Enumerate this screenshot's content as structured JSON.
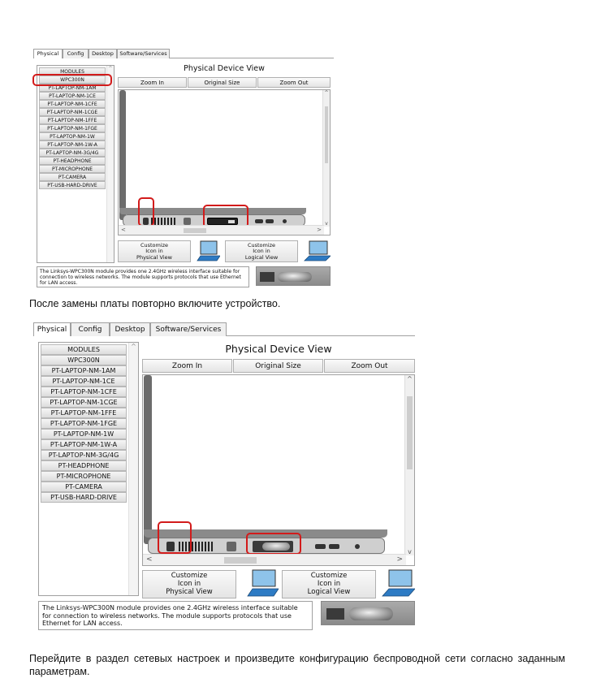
{
  "tabs": [
    "Physical",
    "Config",
    "Desktop",
    "Software/Services"
  ],
  "modules": [
    "MODULES",
    "WPC300N",
    "PT-LAPTOP-NM-1AM",
    "PT-LAPTOP-NM-1CE",
    "PT-LAPTOP-NM-1CFE",
    "PT-LAPTOP-NM-1CGE",
    "PT-LAPTOP-NM-1FFE",
    "PT-LAPTOP-NM-1FGE",
    "PT-LAPTOP-NM-1W",
    "PT-LAPTOP-NM-1W-A",
    "PT-LAPTOP-NM-3G/4G",
    "PT-HEADPHONE",
    "PT-MICROPHONE",
    "PT-CAMERA",
    "PT-USB-HARD-DRIVE"
  ],
  "view_title": "Physical Device View",
  "zoom_in": "Zoom In",
  "original_size": "Original Size",
  "zoom_out": "Zoom Out",
  "customize_physical": [
    "Customize",
    "Icon in",
    "Physical View"
  ],
  "customize_logical": [
    "Customize",
    "Icon in",
    "Logical View"
  ],
  "description": "The Linksys-WPC300N module provides one 2.4GHz wireless interface suitable for connection to wireless networks. The module supports protocols that use Ethernet for LAN access.",
  "instruction1": "После замены платы повторно включите устройство.",
  "instruction2": "Перейдите в раздел сетевых настроек и произведите конфигурацию беспроводной сети согласно заданным параметрам.",
  "scroll_up": "^",
  "scroll_down": "v",
  "scroll_left": "<",
  "scroll_right": ">"
}
